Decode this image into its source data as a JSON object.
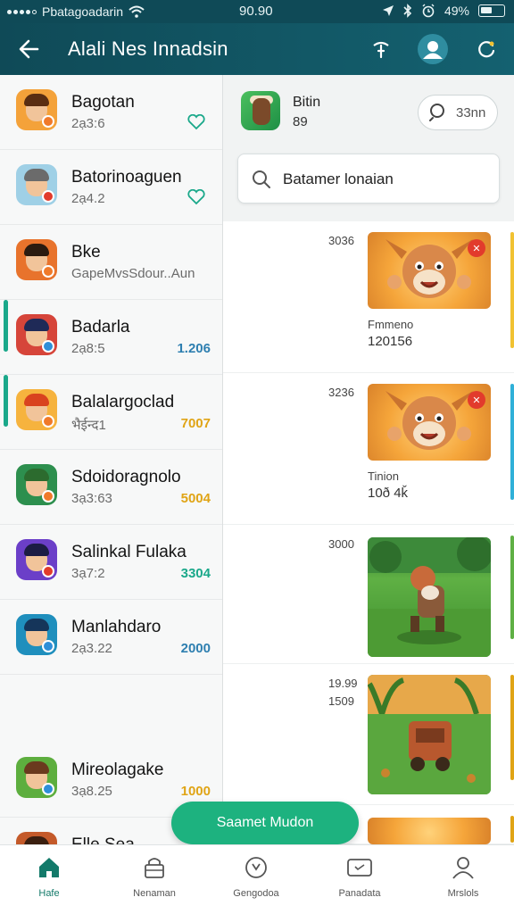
{
  "status_bar": {
    "carrier": "Pbatagoadarin",
    "time": "90.90",
    "battery": "49%",
    "battery_level": 0.49,
    "icons": [
      "signal-dots",
      "wifi-icon",
      "location-icon",
      "bluetooth-icon",
      "alarm-icon",
      "battery-icon"
    ]
  },
  "app_bar": {
    "title": "Alali Nes Innadsin",
    "icons": [
      "back-arrow-icon",
      "antenna-icon",
      "profile-icon",
      "refresh-icon"
    ]
  },
  "list": {
    "items": [
      {
        "title": "Bagotan",
        "sub": "2ạ3:6",
        "num": "",
        "action": "heart",
        "colors": {
          "bg": "#f4a23a",
          "hair": "#5a2e12",
          "badge": "#f07a2a"
        }
      },
      {
        "title": "Batorinoaguen",
        "sub": "2ạ4.2",
        "num": "",
        "action": "heart",
        "colors": {
          "bg": "#9fd0e6",
          "hair": "#6b6b6b",
          "badge": "#e23b2c"
        }
      },
      {
        "title": "Bke",
        "sub": "GapeMvsSdour..Aun",
        "num": "",
        "action": "",
        "colors": {
          "bg": "#e8732c",
          "hair": "#2b1b10",
          "badge": "#f07a2a"
        }
      },
      {
        "title": "Badarla",
        "sub": "2ạ8:5",
        "num": "1.206",
        "num_color": "#2e7fb0",
        "accent": true,
        "colors": {
          "bg": "#d6453a",
          "hair": "#1f2a57",
          "badge": "#2f8fd8"
        }
      },
      {
        "title": "Balalargoclad",
        "sub": "भैईन्द1",
        "num": "7007",
        "num_color": "#e0a415",
        "accent": true,
        "colors": {
          "bg": "#f6b33e",
          "hair": "#d9431f",
          "badge": "#f07a2a"
        }
      },
      {
        "title": "Sdoidoragnolo",
        "sub": "3ạ3:63",
        "num": "5004",
        "num_color": "#e0a415",
        "accent": false,
        "colors": {
          "bg": "#2d8f4e",
          "hair": "#2c6b2e",
          "badge": "#f07a2a"
        }
      },
      {
        "title": "Salinkal Fulaka",
        "sub": "3ạ7:2",
        "num": "3304",
        "num_color": "#1aa88a",
        "accent": false,
        "colors": {
          "bg": "#6b3fc8",
          "hair": "#1c1c44",
          "badge": "#e23b2c"
        }
      },
      {
        "title": "Manlahdaro",
        "sub": "2ạ3.22",
        "num": "2000",
        "num_color": "#2e7fb0",
        "accent": false,
        "colors": {
          "bg": "#1f8fbd",
          "hair": "#15355a",
          "badge": "#2f8fd8"
        }
      },
      {
        "title": "Mireolagake",
        "sub": "3ạ8.25",
        "num": "1000",
        "num_color": "#e0a415",
        "accent": false,
        "colors": {
          "bg": "#5dae3e",
          "hair": "#6a3a1e",
          "badge": "#2f8fd8"
        }
      },
      {
        "title": "Elle Sea...",
        "sub": "",
        "num": "",
        "accent": false,
        "colors": {
          "bg": "#c45a2a",
          "hair": "#3b1f10",
          "badge": "#f07a2a"
        }
      }
    ]
  },
  "detail": {
    "app_name": "Bitin",
    "app_count": "89",
    "pill_text": "33nn",
    "search_value": "Batamer lonaian",
    "feed": [
      {
        "top": "3036",
        "label": "Fmmeno",
        "value": "120156",
        "thumb": "orange-creature",
        "has_close": true,
        "edge": "#f1c232"
      },
      {
        "top": "3236",
        "label": "Tinion",
        "value": "10ð 4ǩ",
        "thumb": "orange-creature",
        "has_close": true,
        "edge": "#2fb0d8"
      },
      {
        "top": "3000",
        "label": "",
        "value": "",
        "thumb": "jungle-warrior",
        "has_close": false,
        "edge": "#5fb044"
      },
      {
        "top": "19.99",
        "top2": "1509",
        "label": "",
        "value": "",
        "thumb": "jungle-cart",
        "has_close": false,
        "edge": "#e0a415"
      },
      {
        "top": "",
        "label": "",
        "value": "",
        "thumb": "partial-orange",
        "has_close": false,
        "edge": "#e0a415"
      }
    ]
  },
  "fab": {
    "label": "Saamet Mudon"
  },
  "bottom_nav": {
    "items": [
      {
        "label": "Hafe",
        "icon": "home-icon",
        "active": true
      },
      {
        "label": "Nenaman",
        "icon": "lock-icon",
        "active": false
      },
      {
        "label": "Gengodoa",
        "icon": "clock-icon",
        "active": false
      },
      {
        "label": "Panadata",
        "icon": "tv-icon",
        "active": false
      },
      {
        "label": "Mrslols",
        "icon": "person-icon",
        "active": false
      }
    ]
  },
  "colors": {
    "header": "#0f4a57",
    "accent_green": "#1aa88a",
    "fab": "#1db27f"
  }
}
